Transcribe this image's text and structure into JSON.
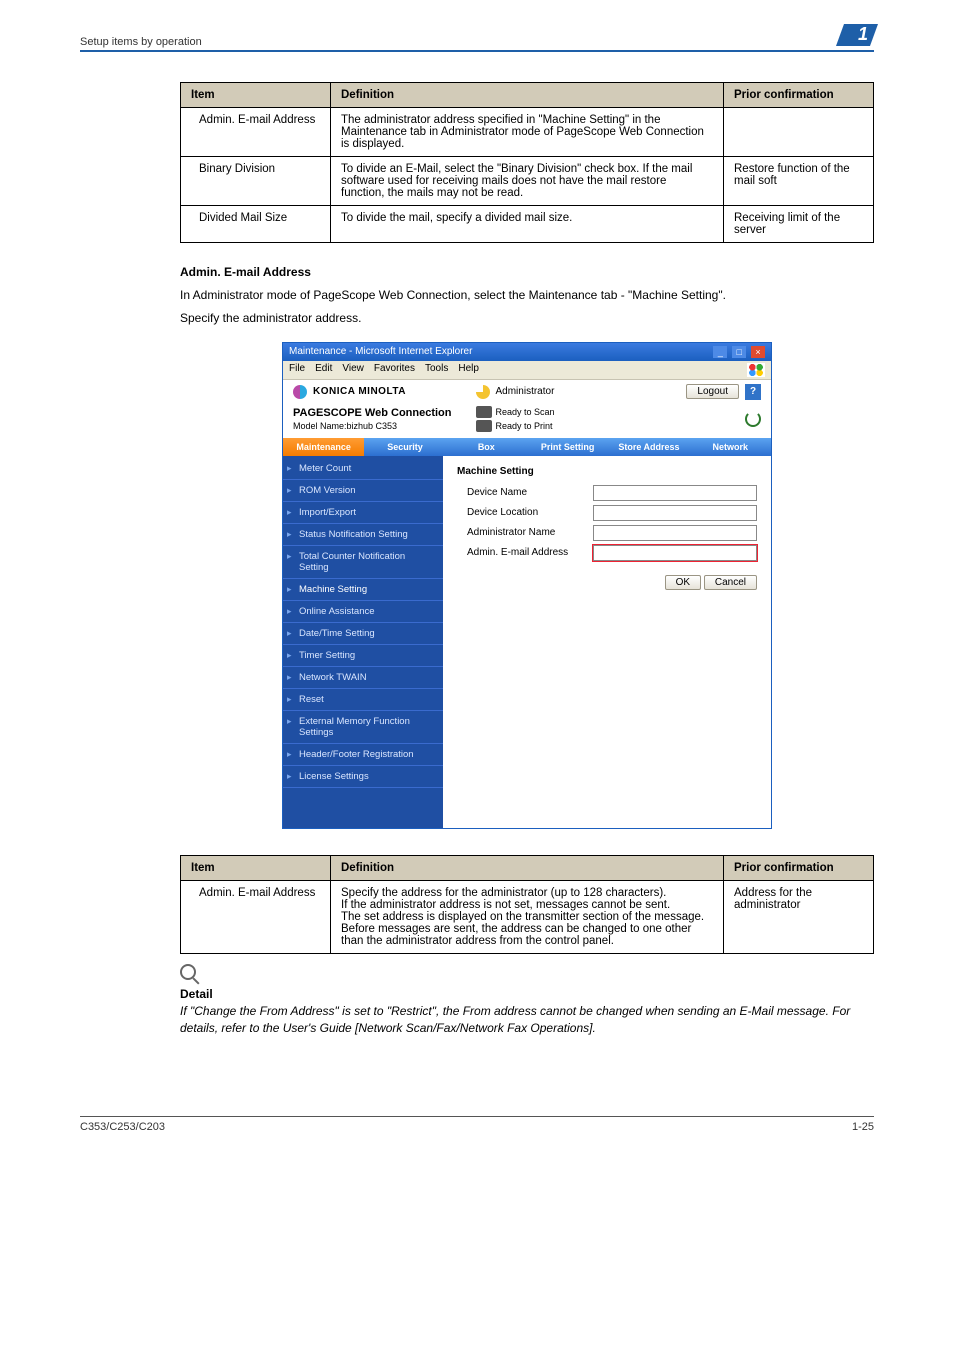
{
  "header": {
    "breadcrumb": "Setup items by operation",
    "chapter_num": "1"
  },
  "table1": {
    "headers": [
      "Item",
      "Definition",
      "Prior confirmation"
    ],
    "rows": [
      {
        "c0": "Admin. E-mail Address",
        "c1": "The administrator address specified in \"Machine Setting\" in the Maintenance tab in Administrator mode of PageScope Web Connection is displayed.",
        "c2": ""
      },
      {
        "c0": "Binary Division",
        "c1": "To divide an E-Mail, select the \"Binary Division\" check box. If the mail software used for receiving mails does not have the mail restore function, the mails may not be read.",
        "c2": "Restore function of the mail soft"
      },
      {
        "c0": "Divided Mail Size",
        "c1": "To divide the mail, specify a divided mail size.",
        "c2": "Receiving limit of the server"
      }
    ]
  },
  "section": {
    "heading": "Admin. E-mail Address",
    "p1": "In Administrator mode of PageScope Web Connection, select the Maintenance tab - \"Machine Setting\".",
    "p2": "Specify the administrator address."
  },
  "ie": {
    "title": "Maintenance - Microsoft Internet Explorer",
    "menu": [
      "File",
      "Edit",
      "View",
      "Favorites",
      "Tools",
      "Help"
    ],
    "brand": "KONICA MINOLTA",
    "admin_label": "Administrator",
    "logout": "Logout",
    "pagescope": "PAGESCOPE Web Connection",
    "model": "Model Name:bizhub C353",
    "status_scan": "Ready to Scan",
    "status_print": "Ready to Print",
    "tabs": [
      "Maintenance",
      "Security",
      "Box",
      "Print Setting",
      "Store Address",
      "Network"
    ],
    "side": [
      "Meter Count",
      "ROM Version",
      "Import/Export",
      "Status Notification Setting",
      "Total Counter Notification Setting",
      "Machine Setting",
      "Online Assistance",
      "Date/Time Setting",
      "Timer Setting",
      "Network TWAIN",
      "Reset",
      "External Memory Function Settings",
      "Header/Footer Registration",
      "License Settings"
    ],
    "form": {
      "heading": "Machine Setting",
      "fields": [
        {
          "label": "Device Name",
          "value": ""
        },
        {
          "label": "Device Location",
          "value": ""
        },
        {
          "label": "Administrator Name",
          "value": ""
        },
        {
          "label": "Admin. E-mail Address",
          "value": "",
          "hl": true
        }
      ],
      "ok": "OK",
      "cancel": "Cancel"
    }
  },
  "table2": {
    "headers": [
      "Item",
      "Definition",
      "Prior confirmation"
    ],
    "rows": [
      {
        "c0": "Admin. E-mail Address",
        "c1": "Specify the address for the administrator (up to 128 characters).\nIf the administrator address is not set, messages cannot be sent.\nThe set address is displayed on the transmitter section of the message. Before messages are sent, the address can be changed to one other than the administrator address from the control panel.",
        "c2": "Address for the administrator"
      }
    ]
  },
  "detail": {
    "label": "Detail",
    "body": "If \"Change the From Address\" is set to \"Restrict\", the From address cannot be changed when sending an E-Mail message. For details, refer to the User's Guide [Network Scan/Fax/Network Fax Operations]."
  },
  "footer": {
    "left": "C353/C253/C203",
    "right": "1-25"
  }
}
